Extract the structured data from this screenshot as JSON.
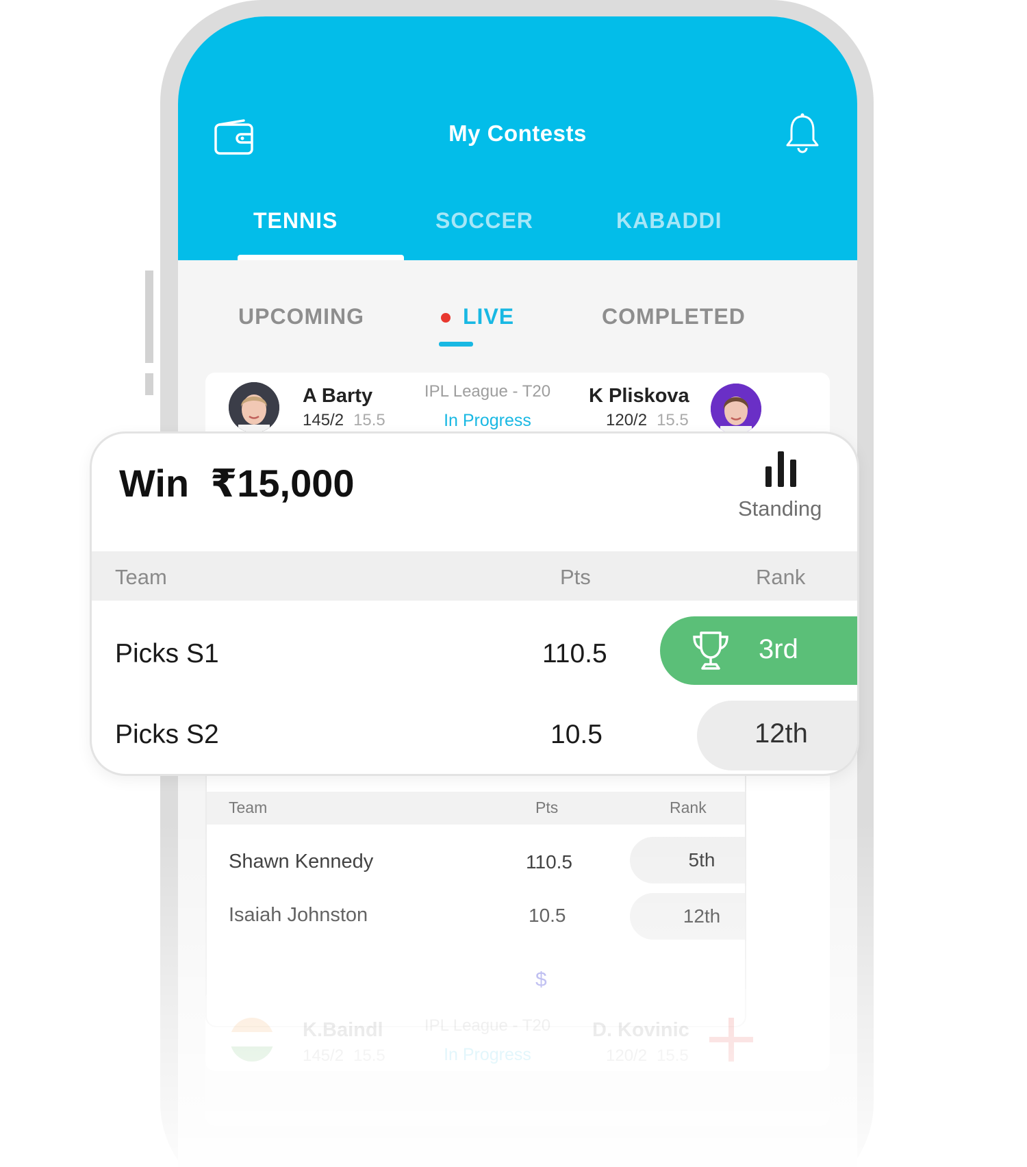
{
  "header": {
    "title": "My Contests",
    "icons": {
      "left": "wallet-icon",
      "right": "bell-icon"
    },
    "sport_tabs": [
      "TENNIS",
      "SOCCER",
      "KABADDI"
    ],
    "active_sport": "TENNIS"
  },
  "status_tabs": {
    "upcoming": "UPCOMING",
    "live": "LIVE",
    "completed": "COMPLETED",
    "active": "LIVE"
  },
  "match": {
    "player1": {
      "name": "A Barty",
      "score": "145/2",
      "overs": "15.5"
    },
    "player2": {
      "name": "K Pliskova",
      "score": "120/2",
      "overs": "15.5"
    },
    "league": "IPL League - T20",
    "status": "In Progress"
  },
  "contest": {
    "win_label": "Win",
    "prize": "₹15,000",
    "standing_label": "Standing",
    "columns": {
      "team": "Team",
      "pts": "Pts",
      "rank": "Rank"
    },
    "rows": [
      {
        "team": "Picks S1",
        "pts": "110.5",
        "rank": "3rd"
      },
      {
        "team": "Picks S2",
        "pts": "10.5",
        "rank": "12th"
      }
    ]
  },
  "background_table": {
    "columns": {
      "team": "Team",
      "pts": "Pts",
      "rank": "Rank"
    },
    "rows": [
      {
        "team": "Shawn Kennedy",
        "pts": "110.5",
        "rank": "5th"
      },
      {
        "team": "Isaiah Johnston",
        "pts": "10.5",
        "rank": "12th"
      }
    ]
  },
  "next_match": {
    "currency_symbol": "$",
    "player1": {
      "name": "K.Baindl",
      "score": "145/2",
      "overs": "15.5"
    },
    "player2": {
      "name": "D. Kovinic",
      "score": "120/2",
      "overs": "15.5"
    },
    "league": "IPL League - T20",
    "status": "In Progress"
  },
  "colors": {
    "header": "#03bde9",
    "accent": "#19b8e3",
    "live_dot": "#e8382f",
    "rank_highlight": "#5bbf78"
  }
}
